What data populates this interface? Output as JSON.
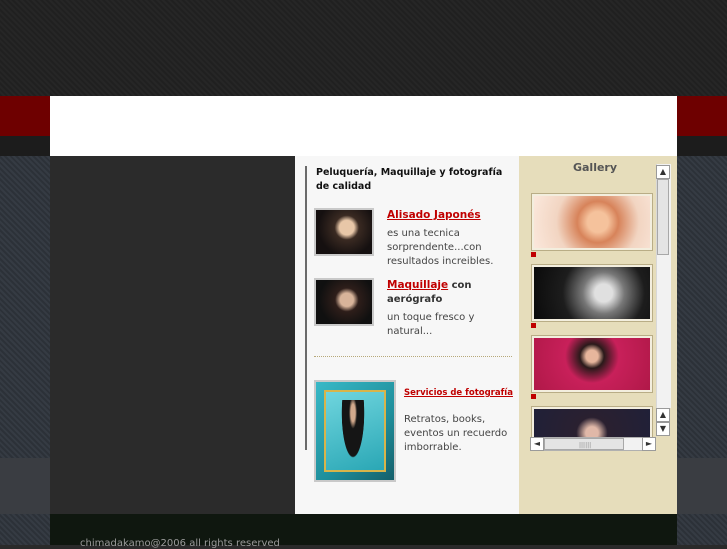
{
  "content": {
    "heading": "Peluquería, Maquillaje y fotografía de calidad",
    "items": [
      {
        "link": "Alisado Japonés",
        "suffix": "",
        "desc": "es una tecnica sorprendente...con resultados increibles.",
        "thumb_icon": "portrait-photo"
      },
      {
        "link": "Maquillaje",
        "suffix": " con aerógrafo",
        "desc": "un toque fresco y natural...",
        "thumb_icon": "portrait-photo"
      }
    ],
    "photo": {
      "link": "Servicios de fotografía",
      "desc": "Retratos, books, eventos un recuerdo imborrable."
    }
  },
  "gallery": {
    "title": "Gallery",
    "scroll_up": "▲",
    "scroll_down": "▼",
    "scroll_left": "◄",
    "scroll_right": "►",
    "grip": "||||||"
  },
  "footer": {
    "text": "chimadakamo@2006 all rights reserved"
  },
  "colors": {
    "accent_red": "#c00000",
    "header_red": "#6e0000",
    "gallery_bg": "#e6ddbb"
  }
}
